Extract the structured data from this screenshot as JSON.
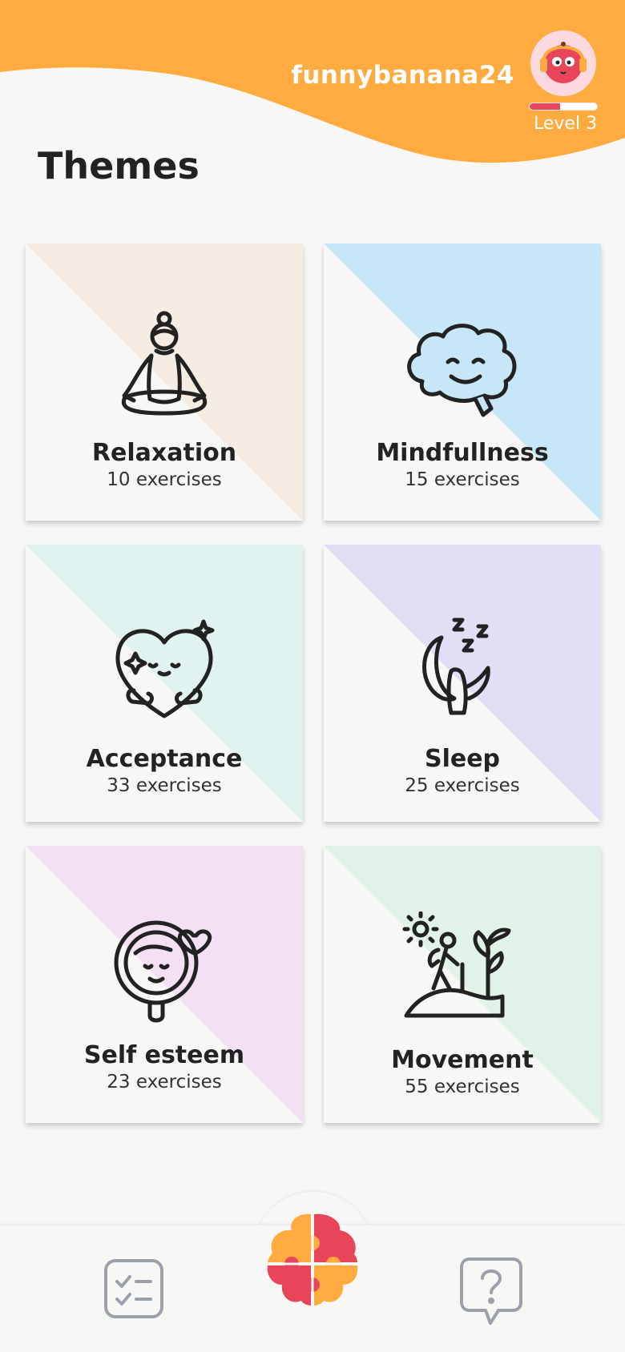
{
  "header": {
    "username": "funnybanana24",
    "level_label": "Level 3",
    "level_progress": 0.45,
    "accent_color": "#ffab40",
    "avatar_icon": "cute-face-headphones-icon"
  },
  "page": {
    "title": "Themes"
  },
  "themes": [
    {
      "title": "Relaxation",
      "subtitle": "10 exercises",
      "icon": "meditation-icon",
      "tint": "#f5ece3"
    },
    {
      "title": "Mindfullness",
      "subtitle": "15 exercises",
      "icon": "brain-icon",
      "tint": "#c7e6f8"
    },
    {
      "title": "Acceptance",
      "subtitle": "33 exercises",
      "icon": "heart-hug-icon",
      "tint": "#e1f3f0"
    },
    {
      "title": "Sleep",
      "subtitle": "25 exercises",
      "icon": "moon-sleep-icon",
      "tint": "#e3ddf6"
    },
    {
      "title": "Self esteem",
      "subtitle": "23 exercises",
      "icon": "mirror-icon",
      "tint": "#f3e1f3"
    },
    {
      "title": "Movement",
      "subtitle": "55 exercises",
      "icon": "hiking-icon",
      "tint": "#e0f3e6"
    }
  ],
  "nav": {
    "left_icon": "checklist-icon",
    "center_icon": "brain-puzzle-icon",
    "right_icon": "help-icon"
  }
}
